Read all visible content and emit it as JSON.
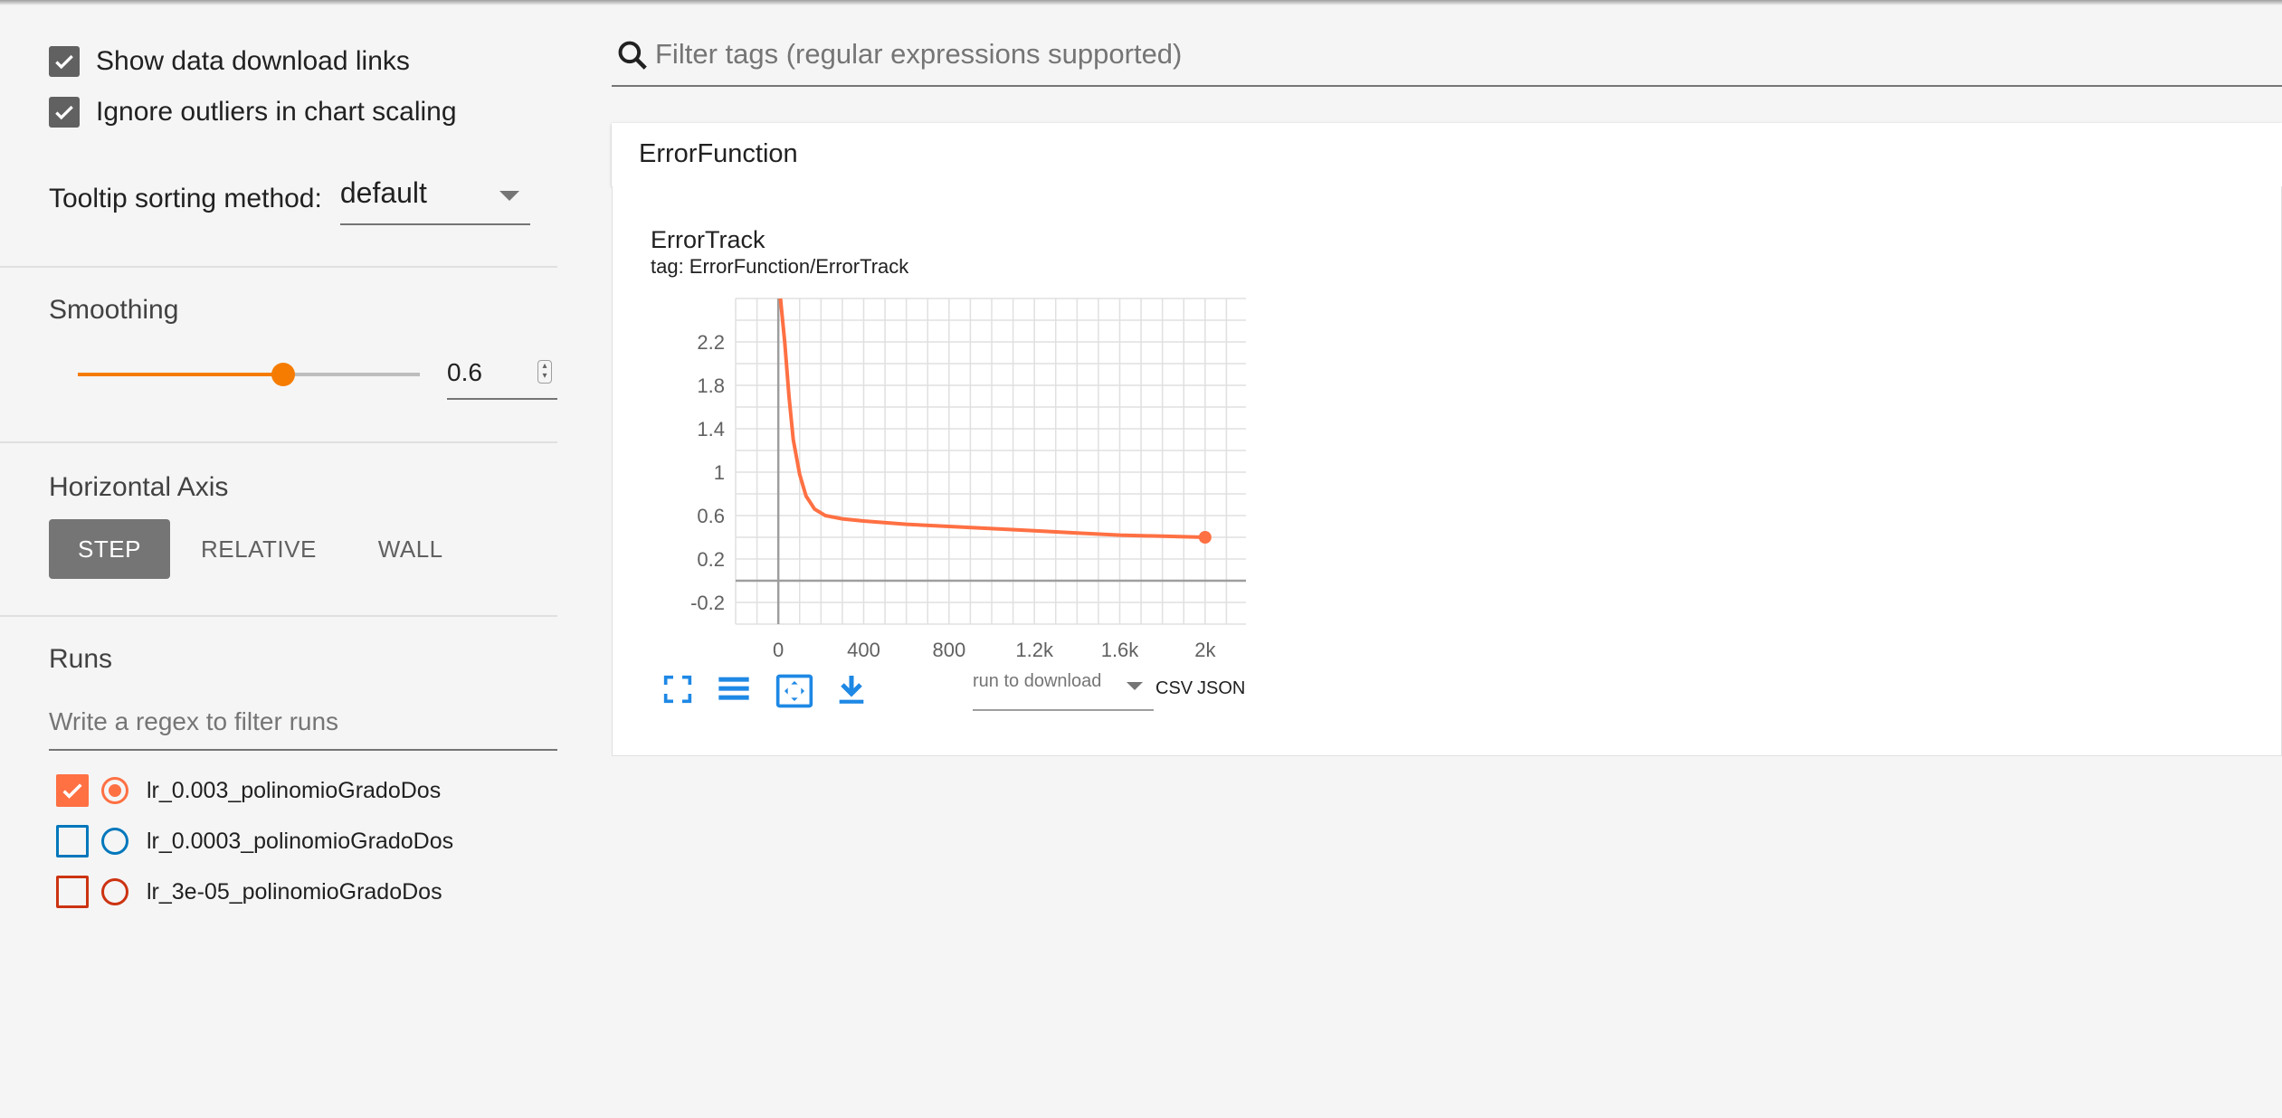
{
  "sidebar": {
    "checkboxes": [
      {
        "label": "Show data download links",
        "checked": true
      },
      {
        "label": "Ignore outliers in chart scaling",
        "checked": true
      }
    ],
    "tooltip": {
      "label": "Tooltip sorting method:",
      "value": "default"
    },
    "smoothing": {
      "title": "Smoothing",
      "value": "0.6",
      "fraction": 0.6
    },
    "horizontal_axis": {
      "title": "Horizontal Axis",
      "options": [
        "STEP",
        "RELATIVE",
        "WALL"
      ],
      "selected": "STEP"
    },
    "runs": {
      "title": "Runs",
      "filter_placeholder": "Write a regex to filter runs",
      "items": [
        {
          "label": "lr_0.003_polinomioGradoDos",
          "checked": true,
          "color": "#ff7043"
        },
        {
          "label": "lr_0.0003_polinomioGradoDos",
          "checked": false,
          "color": "#0077bb"
        },
        {
          "label": "lr_3e-05_polinomioGradoDos",
          "checked": false,
          "color": "#cc3311"
        }
      ]
    }
  },
  "main": {
    "search_placeholder": "Filter tags (regular expressions supported)",
    "category": "ErrorFunction",
    "card": {
      "title": "ErrorTrack",
      "tag": "tag: ErrorFunction/ErrorTrack",
      "download_select": "run to download",
      "csv": "CSV",
      "json": "JSON"
    }
  },
  "icons": [
    "search-icon",
    "fit-domain-icon",
    "log-scale-icon",
    "expand-icon",
    "download-icon"
  ],
  "colors": {
    "accent": "#f57c00",
    "run_line": "#ff7043"
  },
  "chart_data": {
    "type": "line",
    "xlim": [
      -200,
      2200
    ],
    "ylim": [
      -0.4,
      2.6
    ],
    "x_ticks": [
      0,
      400,
      800,
      1200,
      1600,
      2000
    ],
    "x_tick_labels": [
      "0",
      "400",
      "800",
      "1.2k",
      "1.6k",
      "2k"
    ],
    "y_ticks": [
      -0.2,
      0.2,
      0.6,
      1.0,
      1.4,
      1.8,
      2.2
    ],
    "y_tick_labels": [
      "-0.2",
      "0.2",
      "0.6",
      "1",
      "1.4",
      "1.8",
      "2.2"
    ],
    "series": [
      {
        "name": "lr_0.003_polinomioGradoDos",
        "x": [
          10,
          30,
          50,
          70,
          100,
          130,
          170,
          220,
          300,
          400,
          600,
          800,
          1000,
          1200,
          1400,
          1600,
          1800,
          2000
        ],
        "y": [
          2.6,
          2.2,
          1.7,
          1.3,
          0.98,
          0.78,
          0.66,
          0.6,
          0.57,
          0.55,
          0.52,
          0.5,
          0.48,
          0.46,
          0.44,
          0.42,
          0.41,
          0.4
        ]
      }
    ]
  }
}
